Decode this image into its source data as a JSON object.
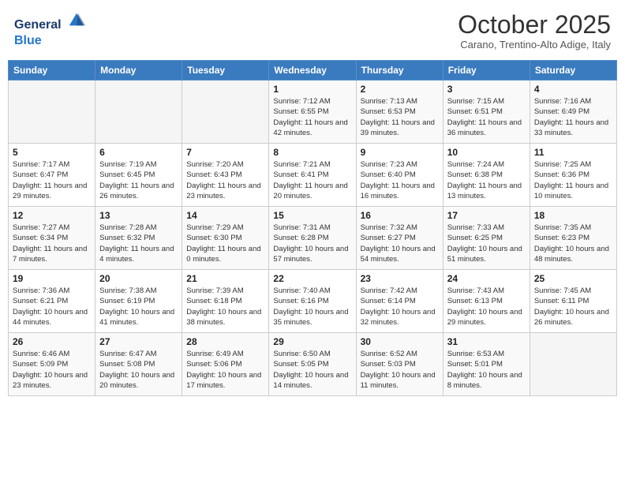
{
  "header": {
    "logo_general": "General",
    "logo_blue": "Blue",
    "month": "October 2025",
    "location": "Carano, Trentino-Alto Adige, Italy"
  },
  "days_of_week": [
    "Sunday",
    "Monday",
    "Tuesday",
    "Wednesday",
    "Thursday",
    "Friday",
    "Saturday"
  ],
  "weeks": [
    [
      {
        "day": "",
        "text": ""
      },
      {
        "day": "",
        "text": ""
      },
      {
        "day": "",
        "text": ""
      },
      {
        "day": "1",
        "text": "Sunrise: 7:12 AM\nSunset: 6:55 PM\nDaylight: 11 hours and 42 minutes."
      },
      {
        "day": "2",
        "text": "Sunrise: 7:13 AM\nSunset: 6:53 PM\nDaylight: 11 hours and 39 minutes."
      },
      {
        "day": "3",
        "text": "Sunrise: 7:15 AM\nSunset: 6:51 PM\nDaylight: 11 hours and 36 minutes."
      },
      {
        "day": "4",
        "text": "Sunrise: 7:16 AM\nSunset: 6:49 PM\nDaylight: 11 hours and 33 minutes."
      }
    ],
    [
      {
        "day": "5",
        "text": "Sunrise: 7:17 AM\nSunset: 6:47 PM\nDaylight: 11 hours and 29 minutes."
      },
      {
        "day": "6",
        "text": "Sunrise: 7:19 AM\nSunset: 6:45 PM\nDaylight: 11 hours and 26 minutes."
      },
      {
        "day": "7",
        "text": "Sunrise: 7:20 AM\nSunset: 6:43 PM\nDaylight: 11 hours and 23 minutes."
      },
      {
        "day": "8",
        "text": "Sunrise: 7:21 AM\nSunset: 6:41 PM\nDaylight: 11 hours and 20 minutes."
      },
      {
        "day": "9",
        "text": "Sunrise: 7:23 AM\nSunset: 6:40 PM\nDaylight: 11 hours and 16 minutes."
      },
      {
        "day": "10",
        "text": "Sunrise: 7:24 AM\nSunset: 6:38 PM\nDaylight: 11 hours and 13 minutes."
      },
      {
        "day": "11",
        "text": "Sunrise: 7:25 AM\nSunset: 6:36 PM\nDaylight: 11 hours and 10 minutes."
      }
    ],
    [
      {
        "day": "12",
        "text": "Sunrise: 7:27 AM\nSunset: 6:34 PM\nDaylight: 11 hours and 7 minutes."
      },
      {
        "day": "13",
        "text": "Sunrise: 7:28 AM\nSunset: 6:32 PM\nDaylight: 11 hours and 4 minutes."
      },
      {
        "day": "14",
        "text": "Sunrise: 7:29 AM\nSunset: 6:30 PM\nDaylight: 11 hours and 0 minutes."
      },
      {
        "day": "15",
        "text": "Sunrise: 7:31 AM\nSunset: 6:28 PM\nDaylight: 10 hours and 57 minutes."
      },
      {
        "day": "16",
        "text": "Sunrise: 7:32 AM\nSunset: 6:27 PM\nDaylight: 10 hours and 54 minutes."
      },
      {
        "day": "17",
        "text": "Sunrise: 7:33 AM\nSunset: 6:25 PM\nDaylight: 10 hours and 51 minutes."
      },
      {
        "day": "18",
        "text": "Sunrise: 7:35 AM\nSunset: 6:23 PM\nDaylight: 10 hours and 48 minutes."
      }
    ],
    [
      {
        "day": "19",
        "text": "Sunrise: 7:36 AM\nSunset: 6:21 PM\nDaylight: 10 hours and 44 minutes."
      },
      {
        "day": "20",
        "text": "Sunrise: 7:38 AM\nSunset: 6:19 PM\nDaylight: 10 hours and 41 minutes."
      },
      {
        "day": "21",
        "text": "Sunrise: 7:39 AM\nSunset: 6:18 PM\nDaylight: 10 hours and 38 minutes."
      },
      {
        "day": "22",
        "text": "Sunrise: 7:40 AM\nSunset: 6:16 PM\nDaylight: 10 hours and 35 minutes."
      },
      {
        "day": "23",
        "text": "Sunrise: 7:42 AM\nSunset: 6:14 PM\nDaylight: 10 hours and 32 minutes."
      },
      {
        "day": "24",
        "text": "Sunrise: 7:43 AM\nSunset: 6:13 PM\nDaylight: 10 hours and 29 minutes."
      },
      {
        "day": "25",
        "text": "Sunrise: 7:45 AM\nSunset: 6:11 PM\nDaylight: 10 hours and 26 minutes."
      }
    ],
    [
      {
        "day": "26",
        "text": "Sunrise: 6:46 AM\nSunset: 5:09 PM\nDaylight: 10 hours and 23 minutes."
      },
      {
        "day": "27",
        "text": "Sunrise: 6:47 AM\nSunset: 5:08 PM\nDaylight: 10 hours and 20 minutes."
      },
      {
        "day": "28",
        "text": "Sunrise: 6:49 AM\nSunset: 5:06 PM\nDaylight: 10 hours and 17 minutes."
      },
      {
        "day": "29",
        "text": "Sunrise: 6:50 AM\nSunset: 5:05 PM\nDaylight: 10 hours and 14 minutes."
      },
      {
        "day": "30",
        "text": "Sunrise: 6:52 AM\nSunset: 5:03 PM\nDaylight: 10 hours and 11 minutes."
      },
      {
        "day": "31",
        "text": "Sunrise: 6:53 AM\nSunset: 5:01 PM\nDaylight: 10 hours and 8 minutes."
      },
      {
        "day": "",
        "text": ""
      }
    ]
  ]
}
